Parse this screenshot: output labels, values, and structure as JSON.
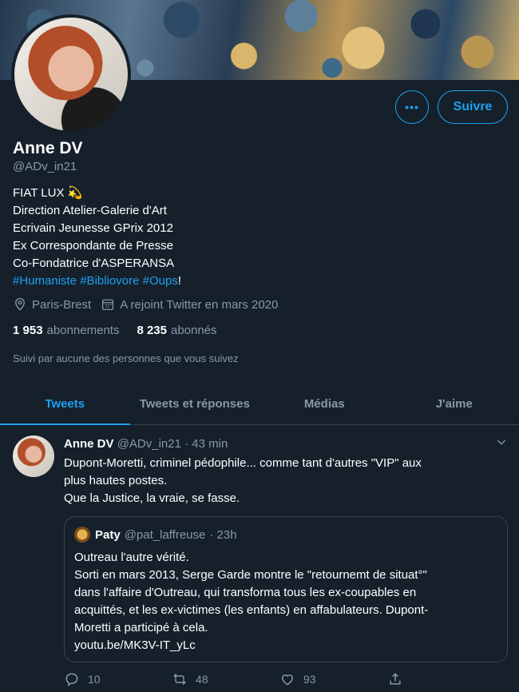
{
  "profile": {
    "name": "Anne DV",
    "handle": "@ADv_in21",
    "bio_lines": [
      "FIAT LUX 💫",
      "Direction Atelier-Galerie d'Art",
      "Ecrivain Jeunesse GPrix 2012",
      "Ex Correspondante de Presse",
      "Co-Fondatrice d'ASPERANSA"
    ],
    "hashtags": [
      "#Humaniste",
      "#Bibliovore",
      "#Oups"
    ],
    "hashtag_suffix": "!",
    "location": "Paris-Brest",
    "joined": "A rejoint Twitter en mars 2020",
    "following_count": "1 953",
    "following_label": "abonnements",
    "followers_count": "8 235",
    "followers_label": "abonnés",
    "suivi": "Suivi par aucune des personnes que vous suivez",
    "more_label": "•••",
    "follow_label": "Suivre"
  },
  "tabs": [
    {
      "label": "Tweets",
      "active": true
    },
    {
      "label": "Tweets et réponses",
      "active": false
    },
    {
      "label": "Médias",
      "active": false
    },
    {
      "label": "J'aime",
      "active": false
    }
  ],
  "tweet": {
    "author": "Anne DV",
    "handle": "@ADv_in21",
    "time": "· 43 min",
    "lines": [
      "Dupont-Moretti, criminel pédophile... comme tant d'autres \"VIP\" aux",
      "plus hautes postes.",
      "Que la Justice, la vraie, se fasse."
    ],
    "quote": {
      "author": "Paty",
      "handle": "@pat_laffreuse",
      "time": "· 23h",
      "lines": [
        "Outreau l'autre vérité.",
        "Sorti en mars 2013, Serge Garde montre le \"retournemt de situat°\"",
        "dans l'affaire d'Outreau, qui transforma tous les ex-coupables en",
        "acquittés, et les ex-victimes (les enfants) en affabulateurs. Dupont-",
        "Moretti a participé à cela.",
        "youtu.be/MK3V-IT_yLc"
      ]
    },
    "replies": "10",
    "retweets": "48",
    "likes": "93"
  },
  "colors": {
    "background": "#15202b",
    "accent": "#1da1f2",
    "muted": "#8899a6",
    "border": "#38444d"
  }
}
